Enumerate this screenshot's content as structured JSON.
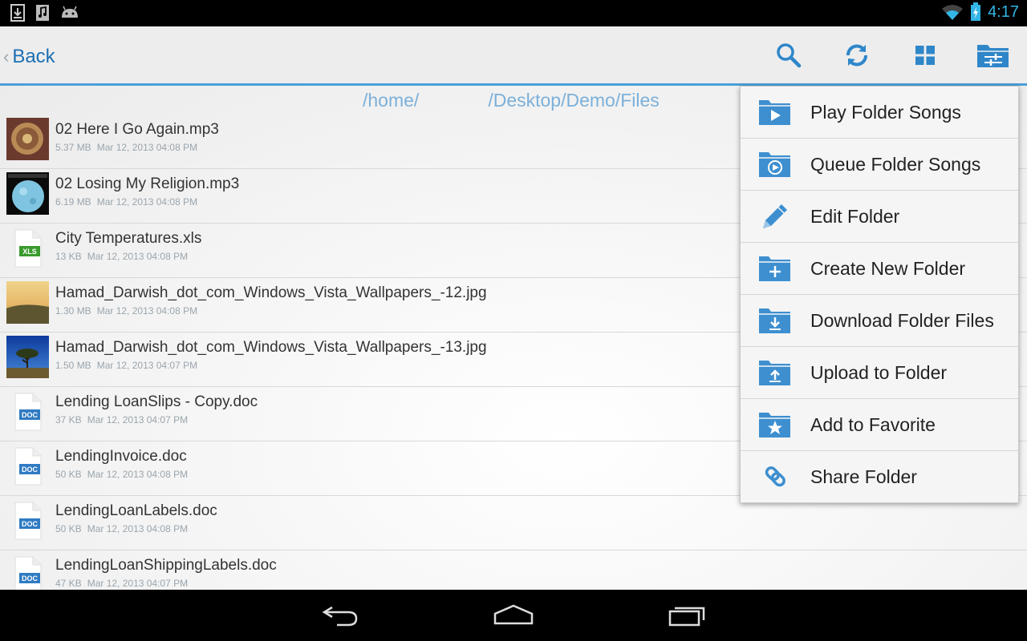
{
  "status_bar": {
    "time": "4:17",
    "left_icons": [
      "download-icon",
      "music-icon",
      "android-icon"
    ],
    "right_icons": [
      "wifi-icon",
      "battery-charging-icon"
    ]
  },
  "action_bar": {
    "back_label": "Back",
    "icons": [
      "search-icon",
      "refresh-icon",
      "grid-view-icon",
      "folder-options-icon"
    ],
    "accent": "#4a9fd8"
  },
  "path": {
    "segment_1": "/home/",
    "segment_2": "/Desktop/Demo/Files"
  },
  "files": [
    {
      "name": "02 Here I Go Again.mp3",
      "size": "5.37 MB",
      "date": "Mar 12, 2013 04:08 PM",
      "thumb": "album-art-1"
    },
    {
      "name": "02 Losing My Religion.mp3",
      "size": "6.19 MB",
      "date": "Mar 12, 2013 04:08 PM",
      "thumb": "album-art-2"
    },
    {
      "name": "City Temperatures.xls",
      "size": "13 KB",
      "date": "Mar 12, 2013 04:08 PM",
      "thumb": "xls"
    },
    {
      "name": "Hamad_Darwish_dot_com_Windows_Vista_Wallpapers_-12.jpg",
      "size": "1.30 MB",
      "date": "Mar 12, 2013 04:08 PM",
      "thumb": "photo-sunset"
    },
    {
      "name": "Hamad_Darwish_dot_com_Windows_Vista_Wallpapers_-13.jpg",
      "size": "1.50 MB",
      "date": "Mar 12, 2013 04:07 PM",
      "thumb": "photo-tree"
    },
    {
      "name": "Lending LoanSlips - Copy.doc",
      "size": "37 KB",
      "date": "Mar 12, 2013 04:07 PM",
      "thumb": "doc"
    },
    {
      "name": "LendingInvoice.doc",
      "size": "50 KB",
      "date": "Mar 12, 2013 04:08 PM",
      "thumb": "doc"
    },
    {
      "name": "LendingLoanLabels.doc",
      "size": "50 KB",
      "date": "Mar 12, 2013 04:08 PM",
      "thumb": "doc"
    },
    {
      "name": "LendingLoanShippingLabels.doc",
      "size": "47 KB",
      "date": "Mar 12, 2013 04:07 PM",
      "thumb": "doc"
    }
  ],
  "file_type_labels": {
    "xls": "XLS",
    "doc": "DOC"
  },
  "menu": [
    {
      "label": "Play Folder Songs",
      "icon": "folder-play-icon"
    },
    {
      "label": "Queue Folder Songs",
      "icon": "folder-queue-icon"
    },
    {
      "label": "Edit Folder",
      "icon": "pencil-icon"
    },
    {
      "label": "Create New Folder",
      "icon": "folder-add-icon"
    },
    {
      "label": "Download Folder Files",
      "icon": "folder-download-icon"
    },
    {
      "label": "Upload to Folder",
      "icon": "folder-upload-icon"
    },
    {
      "label": "Add to Favorite",
      "icon": "folder-star-icon"
    },
    {
      "label": "Share Folder",
      "icon": "link-icon"
    }
  ],
  "nav_bar": {
    "icons": [
      "back-nav-icon",
      "home-nav-icon",
      "recents-nav-icon"
    ]
  }
}
